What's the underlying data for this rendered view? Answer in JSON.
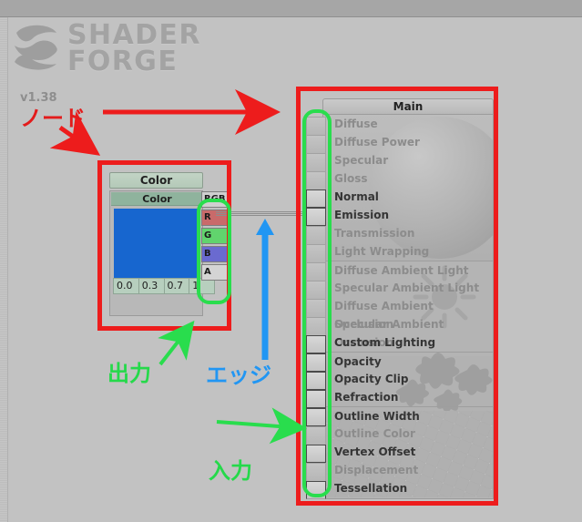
{
  "app": {
    "logo_line1": "SHADER",
    "logo_line2": "FORGE",
    "version": "v1.38",
    "logo_icon": "shader-forge-swirl-icon"
  },
  "color_node": {
    "title": "Color",
    "subtitle": "Color",
    "swatch_color": "#1766cf",
    "values": [
      "0.0",
      "0.3",
      "0.7",
      "1"
    ],
    "ports": [
      {
        "label": "RGB",
        "color": "#cfcfcf",
        "cls": "rgb"
      },
      {
        "label": "R",
        "color": "#c96a6a",
        "cls": "r"
      },
      {
        "label": "G",
        "color": "#61d46d",
        "cls": "g"
      },
      {
        "label": "B",
        "color": "#6a6ad0",
        "cls": "b"
      },
      {
        "label": "A",
        "color": "#d4d4d4",
        "cls": "a"
      }
    ]
  },
  "main_node": {
    "title": "Main",
    "rows": [
      {
        "label": "Diffuse",
        "enabled": false,
        "sep": false
      },
      {
        "label": "Diffuse Power",
        "enabled": false,
        "sep": false
      },
      {
        "label": "Specular",
        "enabled": false,
        "sep": false
      },
      {
        "label": "Gloss",
        "enabled": false,
        "sep": false
      },
      {
        "label": "Normal",
        "enabled": true,
        "sep": false
      },
      {
        "label": "Emission",
        "enabled": true,
        "sep": false
      },
      {
        "label": "Transmission",
        "enabled": false,
        "sep": false
      },
      {
        "label": "Light Wrapping",
        "enabled": false,
        "sep": false
      },
      {
        "label": "Diffuse Ambient Light",
        "enabled": false,
        "sep": true
      },
      {
        "label": "Specular Ambient Light",
        "enabled": false,
        "sep": false
      },
      {
        "label": "Diffuse Ambient Occlusion",
        "enabled": false,
        "sep": false
      },
      {
        "label": "Specular Ambient Occlusion",
        "enabled": false,
        "sep": false
      },
      {
        "label": "Custom Lighting",
        "enabled": true,
        "sep": false
      },
      {
        "label": "Opacity",
        "enabled": true,
        "sep": true
      },
      {
        "label": "Opacity Clip",
        "enabled": true,
        "sep": false
      },
      {
        "label": "Refraction",
        "enabled": true,
        "sep": false
      },
      {
        "label": "Outline Width",
        "enabled": true,
        "sep": true
      },
      {
        "label": "Outline Color",
        "enabled": false,
        "sep": false
      },
      {
        "label": "Vertex Offset",
        "enabled": true,
        "sep": false
      },
      {
        "label": "Displacement",
        "enabled": false,
        "sep": false
      },
      {
        "label": "Tessellation",
        "enabled": true,
        "sep": false
      }
    ]
  },
  "annotations": {
    "node_label": "ノード",
    "output_label": "出力",
    "edge_label": "エッジ",
    "input_label": "入力",
    "red": "#ed1c1c",
    "green": "#29dd4d",
    "blue": "#2196f3"
  }
}
